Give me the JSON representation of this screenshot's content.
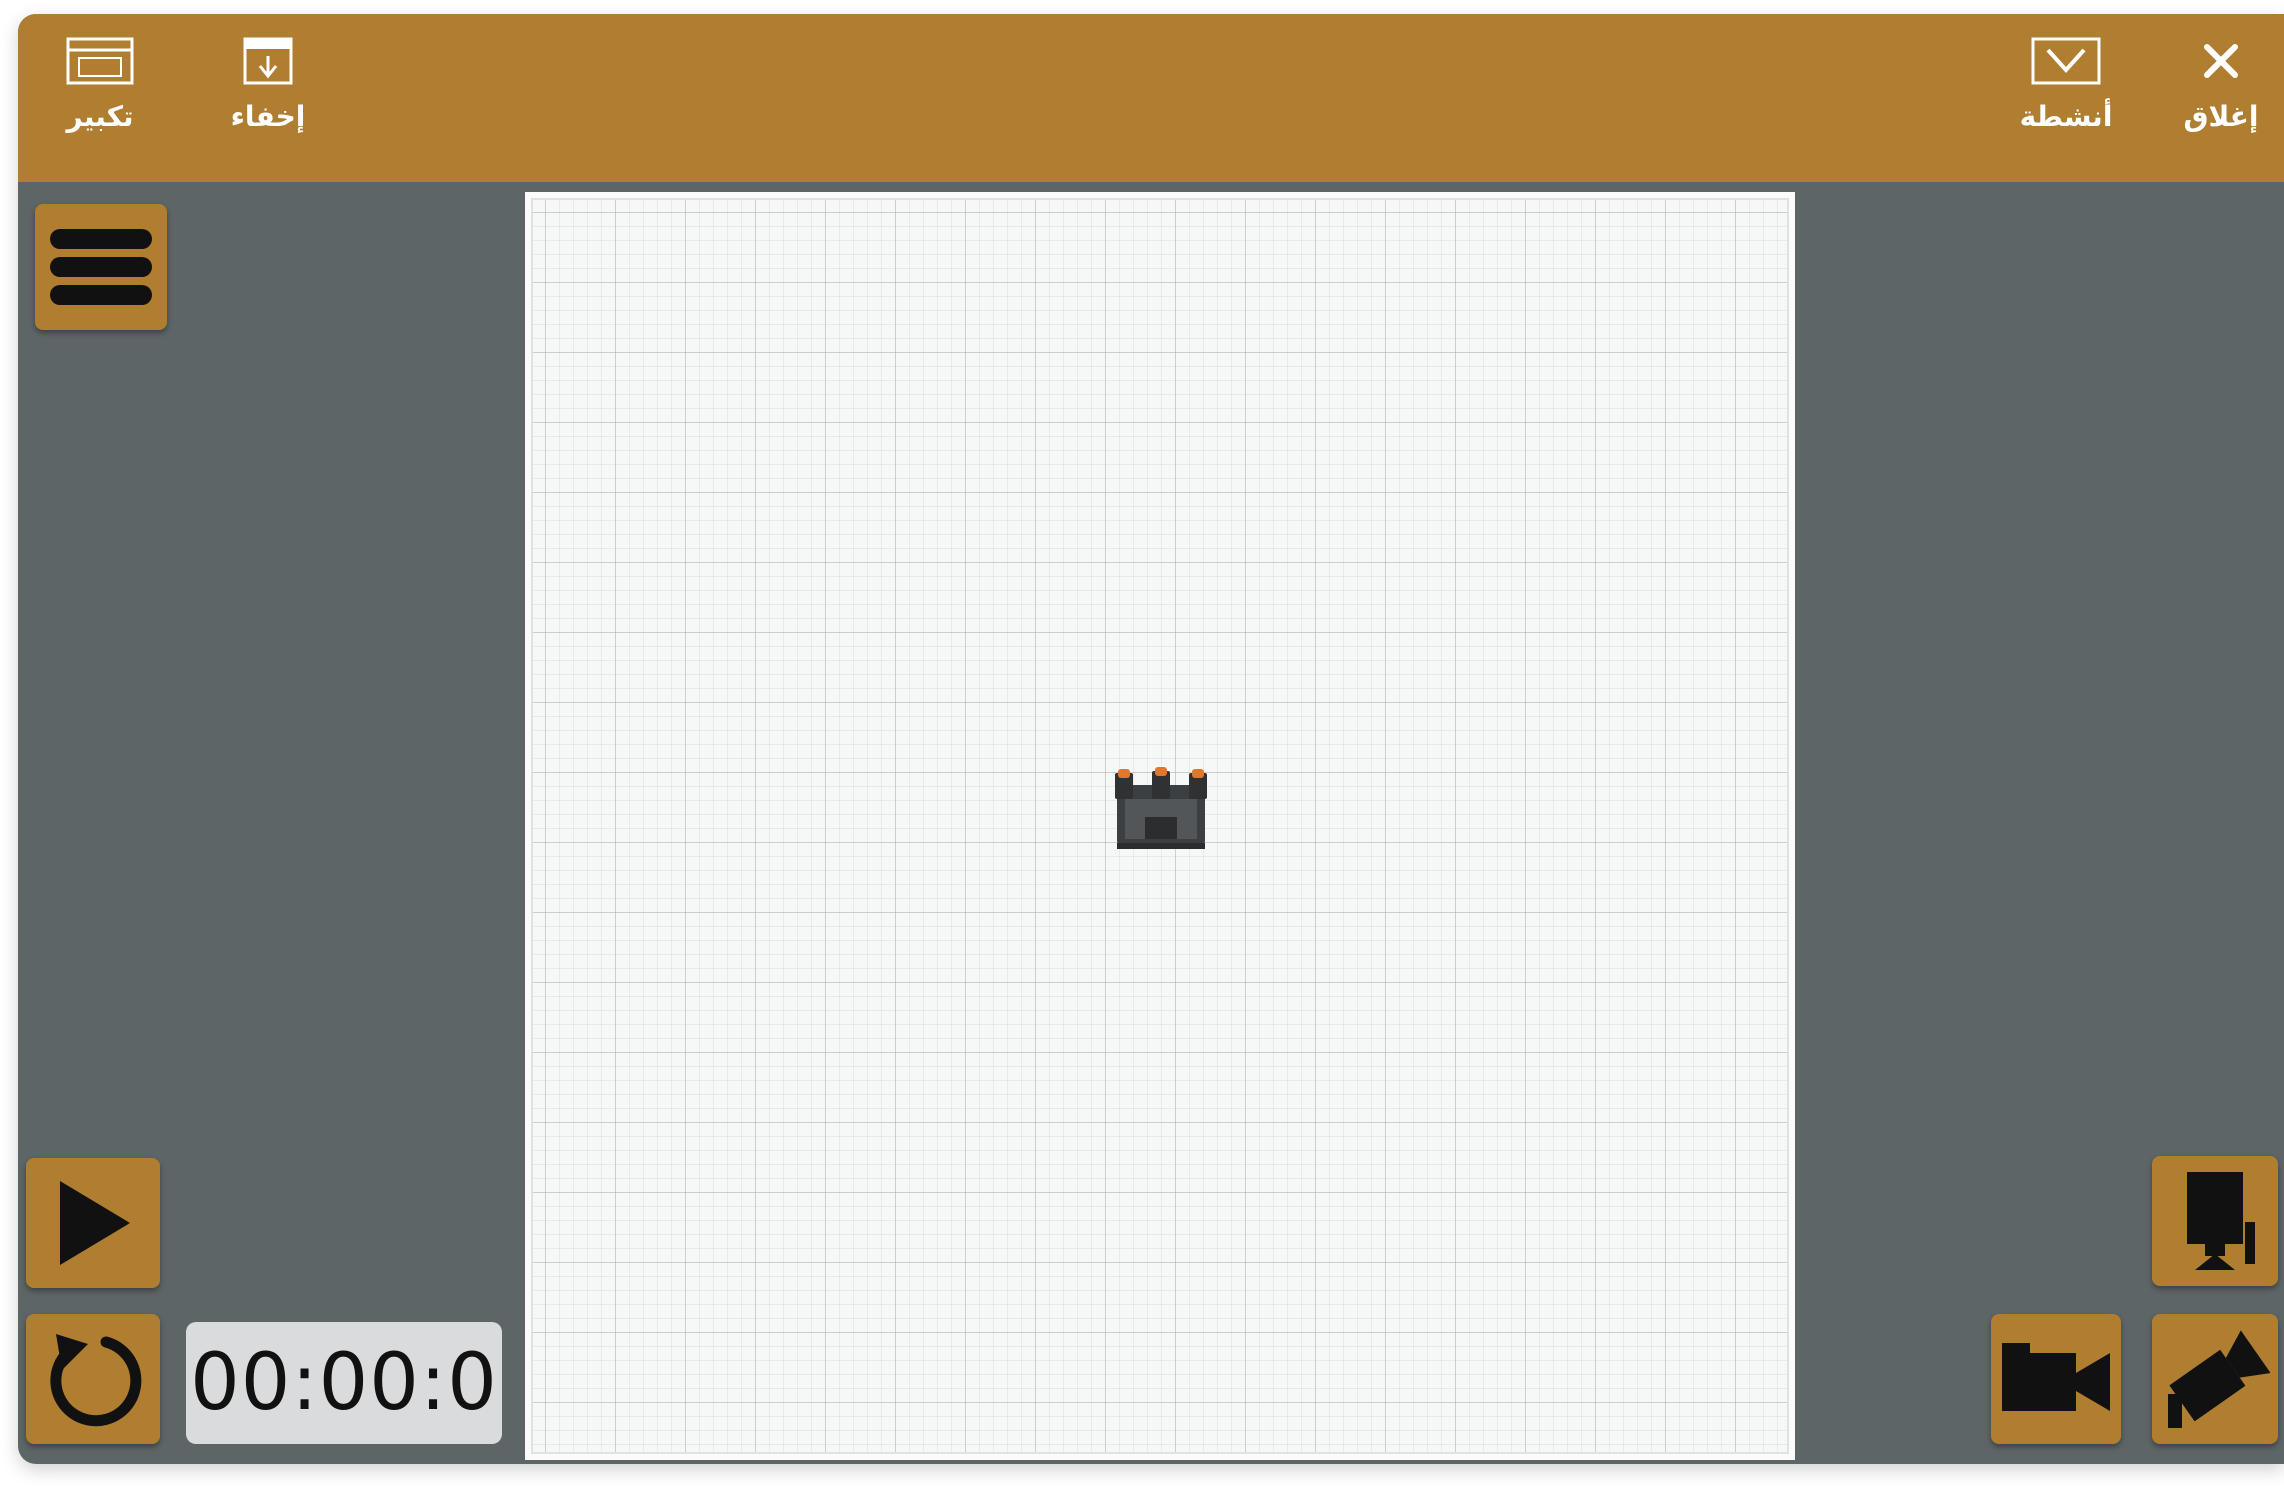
{
  "titlebar": {
    "maximize_label": "تكبير",
    "hide_label": "إخفاء",
    "activities_label": "أنشطة",
    "close_label": "إغلاق"
  },
  "timer": {
    "value": "00:00:0"
  },
  "colors": {
    "accent": "#b07e31",
    "panel": "#5d6566",
    "canvas": "#f6f7f7",
    "timer_bg": "#d9dbdc"
  },
  "icons": {
    "maximize": "maximize-window-icon",
    "hide": "hide-window-icon",
    "activities": "activities-icon",
    "close": "close-icon",
    "menu": "hamburger-menu-icon",
    "play": "play-icon",
    "reset": "reset-icon",
    "camera_top": "top-view-camera-icon",
    "camera_follow": "follow-camera-icon",
    "camera_angle": "angled-camera-icon",
    "robot": "robot-icon"
  }
}
